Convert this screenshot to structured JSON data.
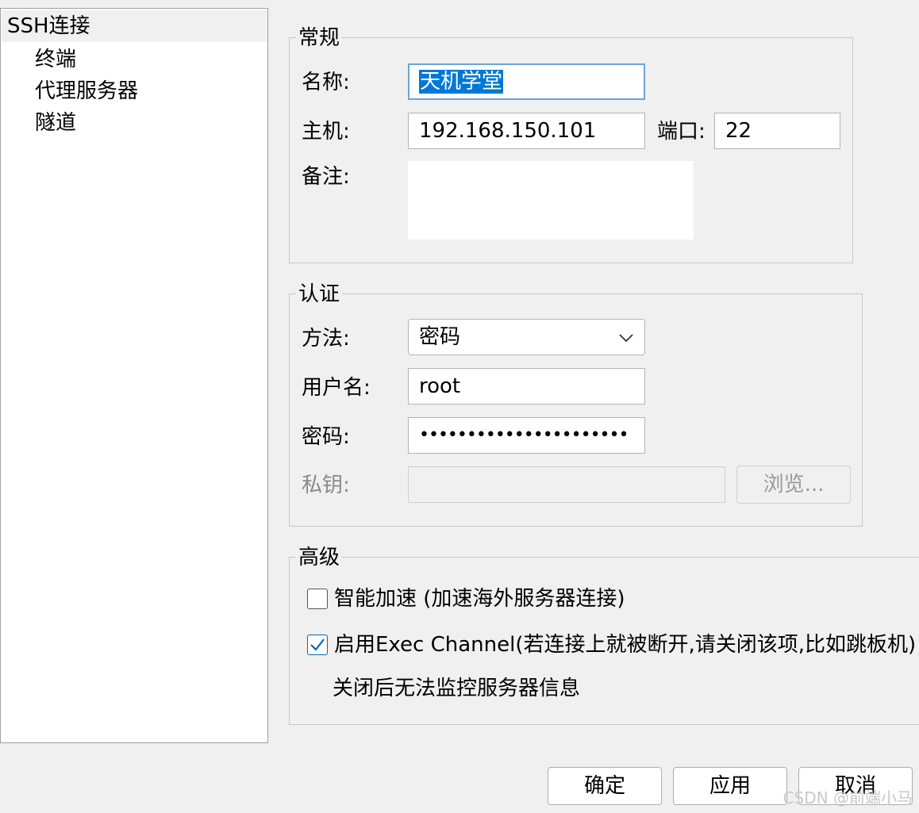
{
  "sidebar": {
    "items": [
      {
        "label": "SSH连接"
      },
      {
        "label": "终端"
      },
      {
        "label": "代理服务器"
      },
      {
        "label": "隧道"
      }
    ]
  },
  "general": {
    "title": "常规",
    "name_label": "名称:",
    "name_value": "天机学堂",
    "host_label": "主机:",
    "host_value": "192.168.150.101",
    "port_label": "端口:",
    "port_value": "22",
    "note_label": "备注:",
    "note_value": ""
  },
  "auth": {
    "title": "认证",
    "method_label": "方法:",
    "method_value": "密码",
    "username_label": "用户名:",
    "username_value": "root",
    "password_label": "密码:",
    "password_value": "••••••••••••••••••••••",
    "key_label": "私钥:",
    "key_value": "",
    "browse_label": "浏览..."
  },
  "advanced": {
    "title": "高级",
    "smart_accel_label": "智能加速 (加速海外服务器连接)",
    "smart_accel_checked": false,
    "exec_channel_label": "启用Exec Channel(若连接上就被断开,请关闭该项,比如跳板机)",
    "exec_channel_checked": true,
    "exec_channel_note": "关闭后无法监控服务器信息"
  },
  "footer": {
    "ok_label": "确定",
    "apply_label": "应用",
    "cancel_label": "取消"
  },
  "watermark": "CSDN @前端小马",
  "colors": {
    "selection": "#0078d7",
    "focus_border": "#6ea3d9",
    "checkbox_accent": "#0067c0"
  }
}
